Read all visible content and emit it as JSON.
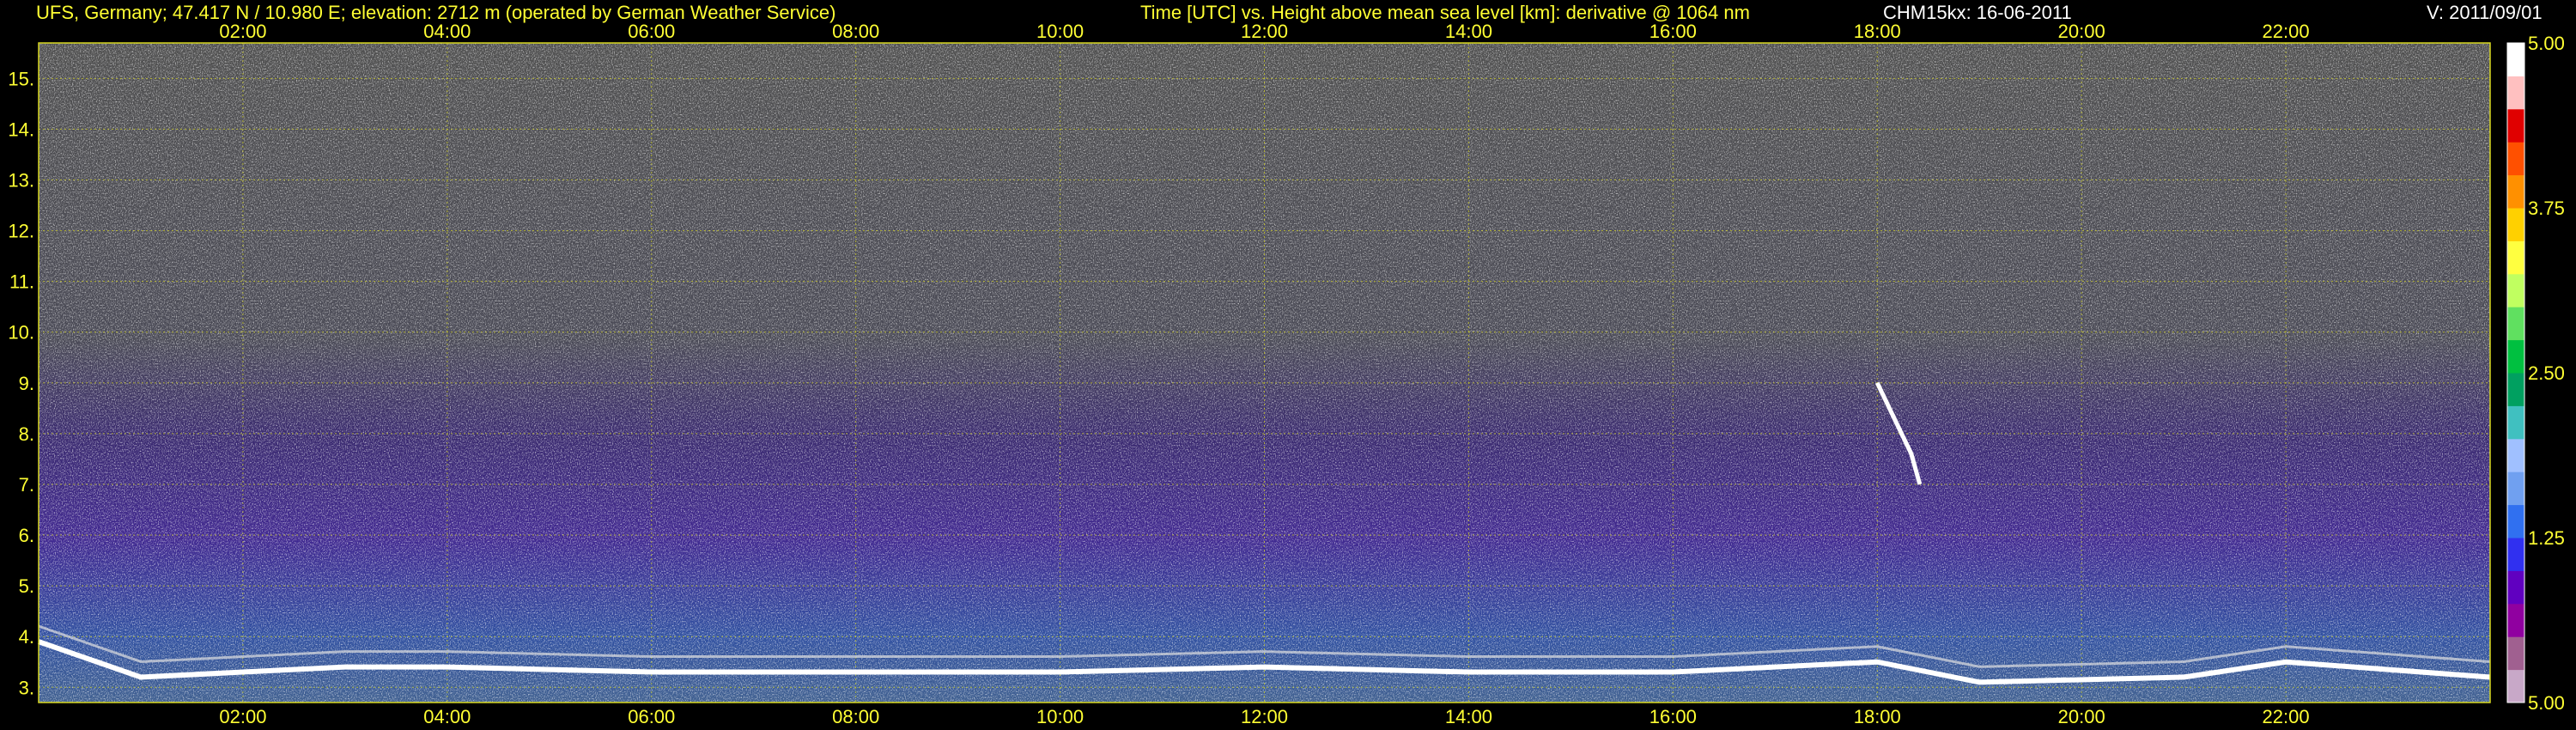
{
  "header": {
    "station": "UFS, Germany; 47.417 N / 10.980 E; elevation: 2712 m  (operated by German Weather Service)",
    "axes_desc": "Time [UTC] vs. Height above mean sea level [km]: derivative @ 1064 nm",
    "instrument": "CHM15kx: 16-06-2011",
    "version": "V: 2011/09/01"
  },
  "chart_data": {
    "type": "heatmap",
    "title": "Time [UTC] vs. Height above mean sea level [km]: derivative @ 1064 nm",
    "xlabel": "Time [UTC]",
    "ylabel": "Height above mean sea level [km]",
    "xlim": [
      "00:00",
      "24:00"
    ],
    "x_ticks": [
      "02:00",
      "04:00",
      "06:00",
      "08:00",
      "10:00",
      "12:00",
      "14:00",
      "16:00",
      "18:00",
      "20:00",
      "22:00"
    ],
    "ylim": [
      2.7,
      15.7
    ],
    "y_ticks": [
      "3.",
      "4.",
      "5.",
      "6.",
      "7.",
      "8.",
      "9.",
      "10.",
      "11.",
      "12.",
      "13.",
      "14.",
      "15."
    ],
    "colorbar": {
      "ticks": [
        "5.00",
        "3.75",
        "2.50",
        "1.25",
        "5.00"
      ],
      "colors": [
        "#c8a8c8",
        "#a06090",
        "#9000a0",
        "#6000c0",
        "#3030f0",
        "#3070f0",
        "#70a0f0",
        "#a0c0ff",
        "#40c0c0",
        "#00a060",
        "#00c040",
        "#60e060",
        "#c0ff60",
        "#ffff40",
        "#ffd000",
        "#ff9000",
        "#ff5000",
        "#e00000",
        "#ffc0c0",
        "#ffffff"
      ]
    },
    "grid": true,
    "features": {
      "boundary_layer_top_km": [
        {
          "t": "00:00",
          "h": 3.9
        },
        {
          "t": "01:00",
          "h": 3.2
        },
        {
          "t": "02:00",
          "h": 3.3
        },
        {
          "t": "03:00",
          "h": 3.4
        },
        {
          "t": "04:00",
          "h": 3.4
        },
        {
          "t": "06:00",
          "h": 3.3
        },
        {
          "t": "08:00",
          "h": 3.3
        },
        {
          "t": "10:00",
          "h": 3.3
        },
        {
          "t": "12:00",
          "h": 3.4
        },
        {
          "t": "14:00",
          "h": 3.3
        },
        {
          "t": "16:00",
          "h": 3.3
        },
        {
          "t": "18:00",
          "h": 3.5
        },
        {
          "t": "19:00",
          "h": 3.1
        },
        {
          "t": "21:00",
          "h": 3.2
        },
        {
          "t": "22:00",
          "h": 3.5
        },
        {
          "t": "24:00",
          "h": 3.2
        }
      ],
      "cloud_streak_km": [
        {
          "t": "18:00",
          "h": 9.0
        },
        {
          "t": "18:10",
          "h": 8.3
        },
        {
          "t": "18:20",
          "h": 7.6
        },
        {
          "t": "18:25",
          "h": 7.0
        }
      ]
    }
  }
}
